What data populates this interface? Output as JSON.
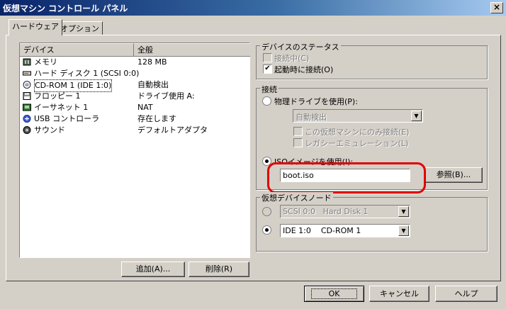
{
  "window": {
    "title": "仮想マシン コントロール パネル",
    "close_label": "×"
  },
  "tabs": [
    {
      "label": "ハードウェア"
    },
    {
      "label": "オプション"
    }
  ],
  "device_list": {
    "headers": {
      "device": "デバイス",
      "summary": "全般"
    },
    "rows": [
      {
        "name": "メモリ",
        "summary": "128 MB",
        "icon": "memory-icon"
      },
      {
        "name": "ハード ディスク 1 (SCSI 0:0)",
        "summary": "",
        "icon": "hard-disk-icon"
      },
      {
        "name": "CD-ROM 1 (IDE 1:0)",
        "summary": "自動検出",
        "icon": "cdrom-icon"
      },
      {
        "name": "フロッピー 1",
        "summary": "ドライブ使用 A:",
        "icon": "floppy-icon"
      },
      {
        "name": "イーサネット 1",
        "summary": "NAT",
        "icon": "ethernet-icon"
      },
      {
        "name": "USB コントローラ",
        "summary": "存在します",
        "icon": "usb-icon"
      },
      {
        "name": "サウンド",
        "summary": "デフォルトアダプタ",
        "icon": "sound-icon"
      }
    ]
  },
  "list_buttons": {
    "add": "追加(A)...",
    "remove": "削除(R)"
  },
  "device_status": {
    "title": "デバイスのステータス",
    "connected": {
      "label": "接続中(C)",
      "checked": false,
      "disabled": true
    },
    "connect_at_power_on": {
      "label": "起動時に接続(O)",
      "checked": true
    }
  },
  "connection": {
    "title": "接続",
    "physical_drive": {
      "label": "物理ドライブを使用(P):",
      "selected": false
    },
    "drive_select": {
      "value": "自動検出"
    },
    "exclusive": {
      "label": "この仮想マシンにのみ接続(E)"
    },
    "legacy": {
      "label": "レガシーエミュレーション(L)"
    },
    "iso": {
      "label": "ISOイメージを使用(I):",
      "selected": true
    },
    "iso_path": {
      "value": "boot.iso"
    },
    "browse_label": "参照(B)..."
  },
  "virtual_device_node": {
    "title": "仮想デバイスノード",
    "scsi": {
      "value": "SCSI 0:0   Hard Disk 1",
      "selected": false
    },
    "ide": {
      "value": "IDE 1:0    CD-ROM 1",
      "selected": true
    }
  },
  "footer": {
    "ok": "OK",
    "cancel": "キャンセル",
    "help": "ヘルプ"
  },
  "colors": {
    "highlight": "#e00000",
    "titlebar": "#0a246a",
    "selection": "#000000"
  }
}
